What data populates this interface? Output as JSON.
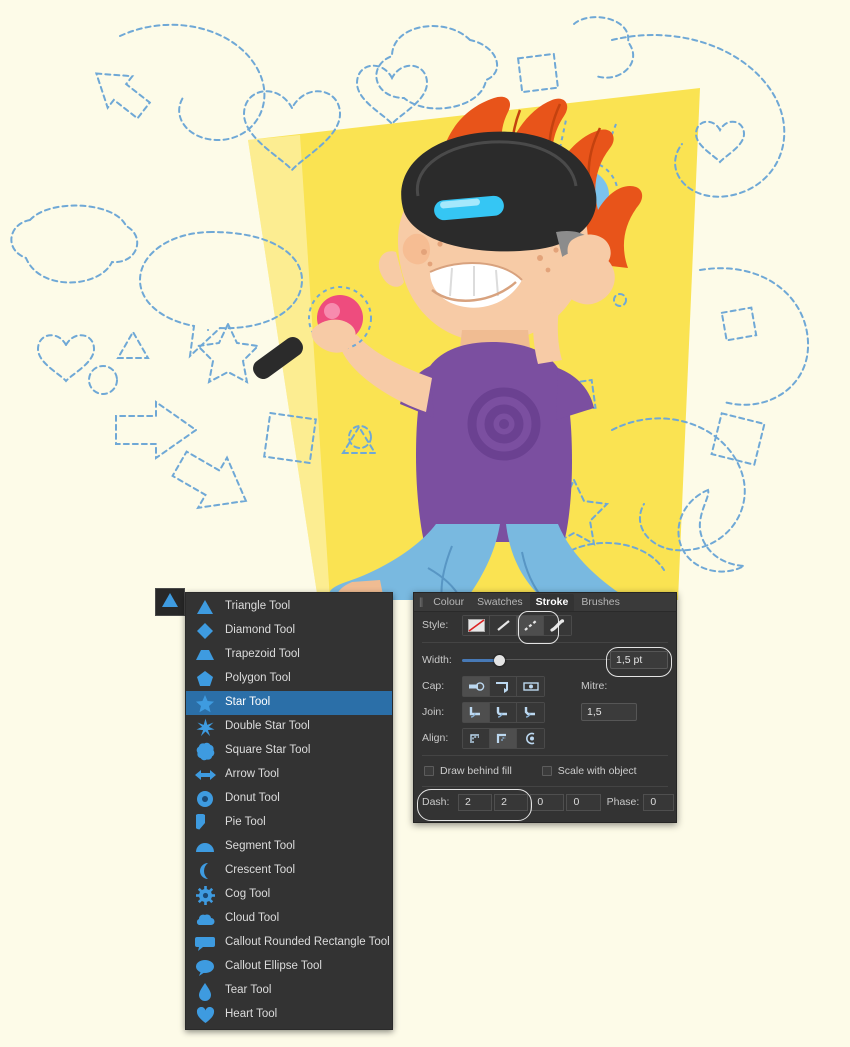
{
  "canvas": {
    "background_color": "#FDFBE8",
    "artwork_color": "#FAE352",
    "description": "Illustration of a child wearing a VR headset holding two motion controllers, surrounded by dashed-outline shapes",
    "colors": {
      "paper": "#FDFBE8",
      "yellow": "#FAE352",
      "hair_orange": "#E8541A",
      "skin": "#F7CBA6",
      "shirt_purple": "#7B4FA0",
      "jeans_blue": "#79B9E0",
      "headset_black": "#2B2B2B",
      "dashed_stroke": "#6FA8D6",
      "controller_pink": "#EE4C7E",
      "controller_blue": "#7CC3EC",
      "visor_cyan": "#35C6F4"
    },
    "dashed_shapes": [
      "heart",
      "cloud",
      "arrow",
      "star",
      "triangle",
      "square",
      "diamond",
      "circle",
      "crescent",
      "speech-bubble",
      "squiggle"
    ]
  },
  "toolbar": {
    "active_tool_icon": "triangle-tool-icon",
    "active_tool_name": "Triangle Tool"
  },
  "tool_menu": {
    "selected": "Star Tool",
    "items": [
      {
        "label": "Triangle Tool",
        "icon": "triangle-icon"
      },
      {
        "label": "Diamond Tool",
        "icon": "diamond-icon"
      },
      {
        "label": "Trapezoid Tool",
        "icon": "trapezoid-icon"
      },
      {
        "label": "Polygon Tool",
        "icon": "polygon-icon"
      },
      {
        "label": "Star Tool",
        "icon": "star-icon"
      },
      {
        "label": "Double Star Tool",
        "icon": "double-star-icon"
      },
      {
        "label": "Square Star Tool",
        "icon": "square-star-icon"
      },
      {
        "label": "Arrow Tool",
        "icon": "arrow-icon"
      },
      {
        "label": "Donut Tool",
        "icon": "donut-icon"
      },
      {
        "label": "Pie Tool",
        "icon": "pie-icon"
      },
      {
        "label": "Segment Tool",
        "icon": "segment-icon"
      },
      {
        "label": "Crescent Tool",
        "icon": "crescent-icon"
      },
      {
        "label": "Cog Tool",
        "icon": "cog-icon"
      },
      {
        "label": "Cloud Tool",
        "icon": "cloud-icon"
      },
      {
        "label": "Callout Rounded Rectangle Tool",
        "icon": "callout-rounded-rectangle-icon"
      },
      {
        "label": "Callout Ellipse Tool",
        "icon": "callout-ellipse-icon"
      },
      {
        "label": "Tear Tool",
        "icon": "tear-icon"
      },
      {
        "label": "Heart Tool",
        "icon": "heart-icon"
      }
    ]
  },
  "stroke_panel": {
    "tabs": [
      {
        "label": "Colour",
        "active": false
      },
      {
        "label": "Swatches",
        "active": false
      },
      {
        "label": "Stroke",
        "active": true
      },
      {
        "label": "Brushes",
        "active": false
      }
    ],
    "style": {
      "label": "Style:",
      "options": [
        "none-stroke-icon",
        "solid-stroke-icon",
        "dashed-stroke-icon",
        "brush-stroke-icon"
      ],
      "selected_index": 2
    },
    "width": {
      "label": "Width:",
      "value": "1,5 pt",
      "slider_percent": 22
    },
    "cap": {
      "label": "Cap:",
      "options": [
        "butt-cap-icon",
        "square-cap-icon",
        "round-cap-icon"
      ],
      "selected_index": 0
    },
    "join": {
      "label": "Join:",
      "options": [
        "miter-join-icon",
        "round-join-icon",
        "bevel-join-icon"
      ],
      "selected_index": 0
    },
    "align": {
      "label": "Align:",
      "options": [
        "align-center-icon",
        "align-inside-icon",
        "align-outside-icon"
      ],
      "selected_index": 1
    },
    "mitre": {
      "label": "Mitre:",
      "value": "1,5"
    },
    "checkboxes": [
      {
        "label": "Draw behind fill",
        "checked": false
      },
      {
        "label": "Scale with object",
        "checked": false
      }
    ],
    "dash": {
      "label": "Dash:",
      "values": [
        "2",
        "2",
        "0",
        "0"
      ],
      "phase_label": "Phase:",
      "phase_value": "0"
    },
    "highlights": [
      "dashed-style-button",
      "width-value-field",
      "dash-fields"
    ]
  }
}
